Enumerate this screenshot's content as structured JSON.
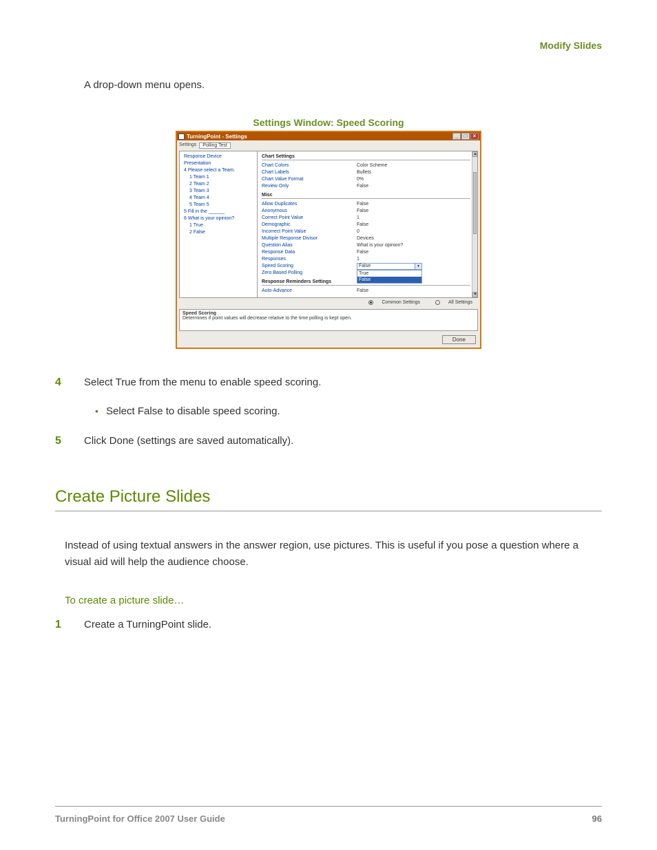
{
  "header": {
    "section": "Modify Slides"
  },
  "intro": "A drop-down menu opens.",
  "figure": {
    "caption": "Settings Window: Speed Scoring",
    "window_title": "TurningPoint - Settings",
    "tabs": {
      "label": "Settings",
      "active": "Polling Test"
    },
    "tree": [
      {
        "text": "Response Device",
        "indent": 0
      },
      {
        "text": "Presentation",
        "indent": 0
      },
      {
        "text": "4  Please select a Team.",
        "indent": 0
      },
      {
        "text": "1  Team 1",
        "indent": 1
      },
      {
        "text": "2  Team 2",
        "indent": 1
      },
      {
        "text": "3  Team 3",
        "indent": 1
      },
      {
        "text": "4  Team 4",
        "indent": 1
      },
      {
        "text": "5  Team 5",
        "indent": 1
      },
      {
        "text": "5  Fill in the ______",
        "indent": 0
      },
      {
        "text": "6  What is your opinion?",
        "indent": 0
      },
      {
        "text": "1  True",
        "indent": 1
      },
      {
        "text": "2  False",
        "indent": 1
      }
    ],
    "groups": [
      {
        "title": "Chart Settings",
        "rows": [
          {
            "key": "Chart Colors",
            "val": "Color Scheme"
          },
          {
            "key": "Chart Labels",
            "val": "Bullets"
          },
          {
            "key": "Chart Value Format",
            "val": "0%"
          },
          {
            "key": "Review Only",
            "val": "False"
          }
        ]
      },
      {
        "title": "Misc",
        "rows": [
          {
            "key": "Allow Duplicates",
            "val": "False"
          },
          {
            "key": "Anonymous",
            "val": "False"
          },
          {
            "key": "Correct Point Value",
            "val": "1"
          },
          {
            "key": "Demographic",
            "val": "False"
          },
          {
            "key": "Incorrect Point Value",
            "val": "0"
          },
          {
            "key": "Multiple Response Divisor",
            "val": "Devices"
          },
          {
            "key": "Question Alias",
            "val": "What is your opinion?"
          },
          {
            "key": "Response Data",
            "val": "False"
          },
          {
            "key": "Responses",
            "val": "1"
          },
          {
            "key": "Speed Scoring",
            "val": "False",
            "dropdown": true,
            "options": [
              "True",
              "False"
            ],
            "selected": "False"
          },
          {
            "key": "Zero Based Polling",
            "val": ""
          }
        ]
      },
      {
        "title": "Response Reminders Settings",
        "rows": [
          {
            "key": "Auto-Advance",
            "val": "False"
          }
        ]
      }
    ],
    "radios": {
      "common": "Common Settings",
      "all": "All Settings"
    },
    "description": {
      "title": "Speed Scoring",
      "body": "Determines if point values will decrease relative to the time polling is kept open."
    },
    "done": "Done"
  },
  "steps": {
    "s4": {
      "num": "4",
      "text": "Select True from the menu to enable speed scoring."
    },
    "s4_bullet": "Select False to disable speed scoring.",
    "s5": {
      "num": "5",
      "text": "Click Done (settings are saved automatically)."
    }
  },
  "section": {
    "heading": "Create Picture Slides",
    "para": "Instead of using textual answers in the answer region, use pictures. This is useful if you pose a question where a visual aid will help the audience choose.",
    "sub": "To create a picture slide…",
    "step1": {
      "num": "1",
      "text": "Create a TurningPoint slide."
    }
  },
  "footer": {
    "left": "TurningPoint for Office 2007 User Guide",
    "right": "96"
  }
}
